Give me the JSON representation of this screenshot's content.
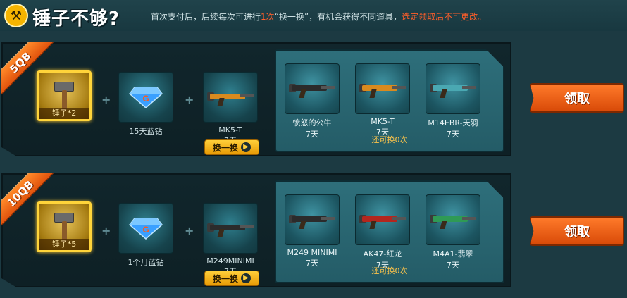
{
  "header": {
    "title": "锤子不够?",
    "notice_prefix": "首次支付后，后续每次可进行",
    "notice_count": "1次",
    "notice_mid": "“换一换”，有机会获得不同道具，",
    "notice_highlight": "选定领取后不可更改。"
  },
  "rows": [
    {
      "price": "5QB",
      "hammer": {
        "label": "锤子*2"
      },
      "item2": {
        "label": "15天蓝钻"
      },
      "item3": {
        "label": "MK5-T",
        "days": "7天"
      },
      "swap_label": "换一换",
      "options": [
        {
          "label": "愤怒的公牛",
          "days": "7天"
        },
        {
          "label": "MK5-T",
          "days": "7天"
        },
        {
          "label": "M14EBR-天羽",
          "days": "7天"
        }
      ],
      "remaining": "还可换0次",
      "claim_label": "领取"
    },
    {
      "price": "10QB",
      "hammer": {
        "label": "锤子*5"
      },
      "item2": {
        "label": "1个月蓝钻"
      },
      "item3": {
        "label": "M249MINIMI",
        "days": "7天"
      },
      "swap_label": "换一换",
      "options": [
        {
          "label": "M249 MINIMI",
          "days": "7天"
        },
        {
          "label": "AK47-红龙",
          "days": "7天"
        },
        {
          "label": "M4A1-翡翠",
          "days": "7天"
        }
      ],
      "remaining": "还可换0次",
      "claim_label": "领取"
    }
  ],
  "colors": {
    "accent_orange": "#e0520c",
    "gold": "#ffd43a",
    "notice_highlight": "#ff5e2a"
  }
}
